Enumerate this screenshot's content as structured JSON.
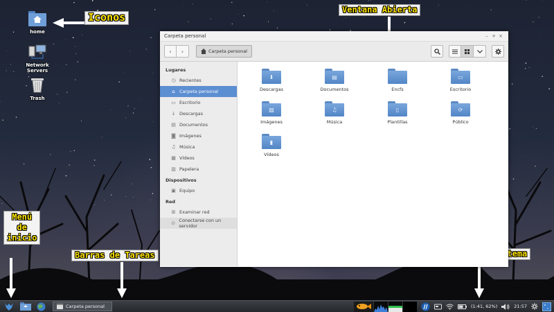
{
  "desktop": {
    "icons": [
      {
        "label": "home",
        "icon": "home-folder-icon"
      },
      {
        "label": "Network Servers",
        "icon": "network-servers-icon"
      },
      {
        "label": "Trash",
        "icon": "trash-icon"
      }
    ]
  },
  "annotations": {
    "icons": "Iconos",
    "window": "Ventana Abierta",
    "menu_line1": "Menú",
    "menu_line2": "de",
    "menu_line3": "inicio",
    "taskbar": "Barras de Tareas",
    "tray": "Bandeja del sistema"
  },
  "window": {
    "title": "Carpeta personal",
    "controls": [
      "–",
      "+",
      "×"
    ],
    "breadcrumb": "Carpeta personal",
    "sidebar": {
      "sections": [
        {
          "heading": "Lugares",
          "items": [
            {
              "label": "Recientes",
              "icon": "clock-icon"
            },
            {
              "label": "Carpeta personal",
              "icon": "home-icon",
              "active": true
            },
            {
              "label": "Escritorio",
              "icon": "desktop-icon"
            },
            {
              "label": "Descargas",
              "icon": "download-icon"
            },
            {
              "label": "Documentos",
              "icon": "document-icon"
            },
            {
              "label": "Imágenes",
              "icon": "camera-icon"
            },
            {
              "label": "Música",
              "icon": "music-icon"
            },
            {
              "label": "Vídeos",
              "icon": "film-icon"
            },
            {
              "label": "Papelera",
              "icon": "trash-icon"
            }
          ]
        },
        {
          "heading": "Dispositivos",
          "items": [
            {
              "label": "Equipo",
              "icon": "drive-icon"
            }
          ]
        },
        {
          "heading": "Red",
          "items": [
            {
              "label": "Examinar red",
              "icon": "network-icon"
            },
            {
              "label": "Conectarse con un servidor",
              "icon": "server-icon"
            }
          ]
        }
      ]
    },
    "files": [
      {
        "label": "Descargas",
        "icon": "download-folder-icon"
      },
      {
        "label": "Documentos",
        "icon": "documents-folder-icon"
      },
      {
        "label": "Encfs",
        "icon": "folder-icon"
      },
      {
        "label": "Escritorio",
        "icon": "desktop-folder-icon"
      },
      {
        "label": "Imágenes",
        "icon": "pictures-folder-icon"
      },
      {
        "label": "Música",
        "icon": "music-folder-icon"
      },
      {
        "label": "Plantillas",
        "icon": "templates-folder-icon"
      },
      {
        "label": "Público",
        "icon": "public-folder-icon"
      },
      {
        "label": "Vídeos",
        "icon": "videos-folder-icon"
      }
    ]
  },
  "taskbar": {
    "task_label": "Carpeta personal",
    "battery": "(1:41, 62%)",
    "clock": "21:57"
  }
}
